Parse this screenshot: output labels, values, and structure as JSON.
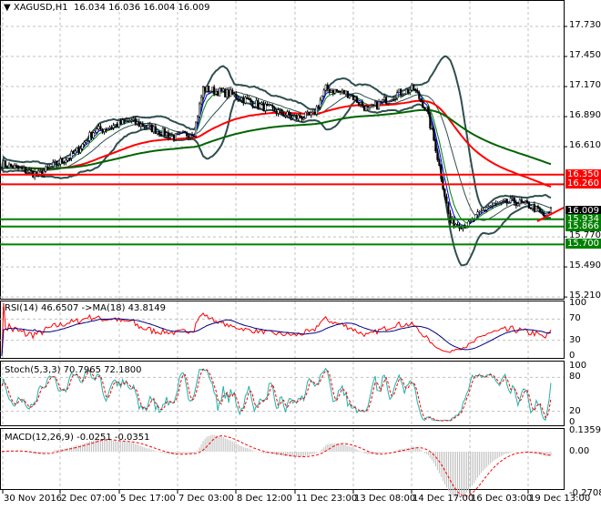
{
  "header": {
    "symbol": "XAGUSD,H1",
    "open": "16.034",
    "high": "16.036",
    "low": "16.004",
    "close": "16.009"
  },
  "price_axis": [
    "17.730",
    "17.450",
    "17.170",
    "16.890",
    "16.610",
    "15.770",
    "15.490",
    "15.210"
  ],
  "level_tags": [
    {
      "value": "16.350",
      "color": "#ff0000",
      "price": 16.35
    },
    {
      "value": "16.260",
      "color": "#ff0000",
      "price": 16.26
    },
    {
      "value": "16.009",
      "color": "#000000",
      "price": 16.009
    },
    {
      "value": "15.934",
      "color": "#008000",
      "price": 15.934
    },
    {
      "value": "15.866",
      "color": "#008000",
      "price": 15.866
    },
    {
      "value": "15.700",
      "color": "#008000",
      "price": 15.7
    }
  ],
  "rsi": {
    "label": "RSI(14) 46.6507  ->MA(18) 43.8149",
    "axis": [
      "100",
      "70",
      "30",
      "0"
    ]
  },
  "stoch": {
    "label": "Stoch(5,3,3) 70.7965 72.1800",
    "axis": [
      "100",
      "80",
      "20",
      "0"
    ]
  },
  "macd": {
    "label": "MACD(12,26,9) -0.0251 -0.0351",
    "axis": [
      "0.1359",
      "0.00",
      "-0.2708"
    ]
  },
  "time_axis": [
    "30 Nov 2016",
    "2 Dec 07:00",
    "5 Dec 17:00",
    "7 Dec 03:00",
    "8 Dec 12:00",
    "11 Dec 23:00",
    "13 Dec 08:00",
    "14 Dec 17:00",
    "16 Dec 03:00",
    "19 Dec 13:00"
  ],
  "chart_data": {
    "type": "line",
    "title": "XAGUSD,H1",
    "bars": 300,
    "close_path": [
      [
        0,
        16.45
      ],
      [
        20,
        16.35
      ],
      [
        40,
        16.55
      ],
      [
        50,
        16.75
      ],
      [
        70,
        16.85
      ],
      [
        95,
        16.7
      ],
      [
        105,
        16.75
      ],
      [
        110,
        17.15
      ],
      [
        125,
        17.1
      ],
      [
        140,
        17.0
      ],
      [
        160,
        16.88
      ],
      [
        170,
        16.9
      ],
      [
        177,
        17.15
      ],
      [
        190,
        17.1
      ],
      [
        200,
        16.95
      ],
      [
        215,
        17.1
      ],
      [
        225,
        17.15
      ],
      [
        232,
        16.95
      ],
      [
        237,
        16.6
      ],
      [
        245,
        15.9
      ],
      [
        255,
        15.88
      ],
      [
        265,
        16.05
      ],
      [
        280,
        16.1
      ],
      [
        290,
        16.05
      ],
      [
        297,
        15.95
      ],
      [
        300,
        16.009
      ]
    ],
    "ylim": [
      15.21,
      17.83
    ],
    "colors": {
      "bands": "#2f4f4f",
      "ma_long": "#006400",
      "ma_mid": "#ff0000",
      "rsi": "#ff0000",
      "rsi_ma": "#000080",
      "stoch_main": "#20b2aa",
      "stoch_signal": "#ff0000",
      "macd_hist": "#c0c0c0",
      "macd_signal": "#ff0000"
    }
  }
}
